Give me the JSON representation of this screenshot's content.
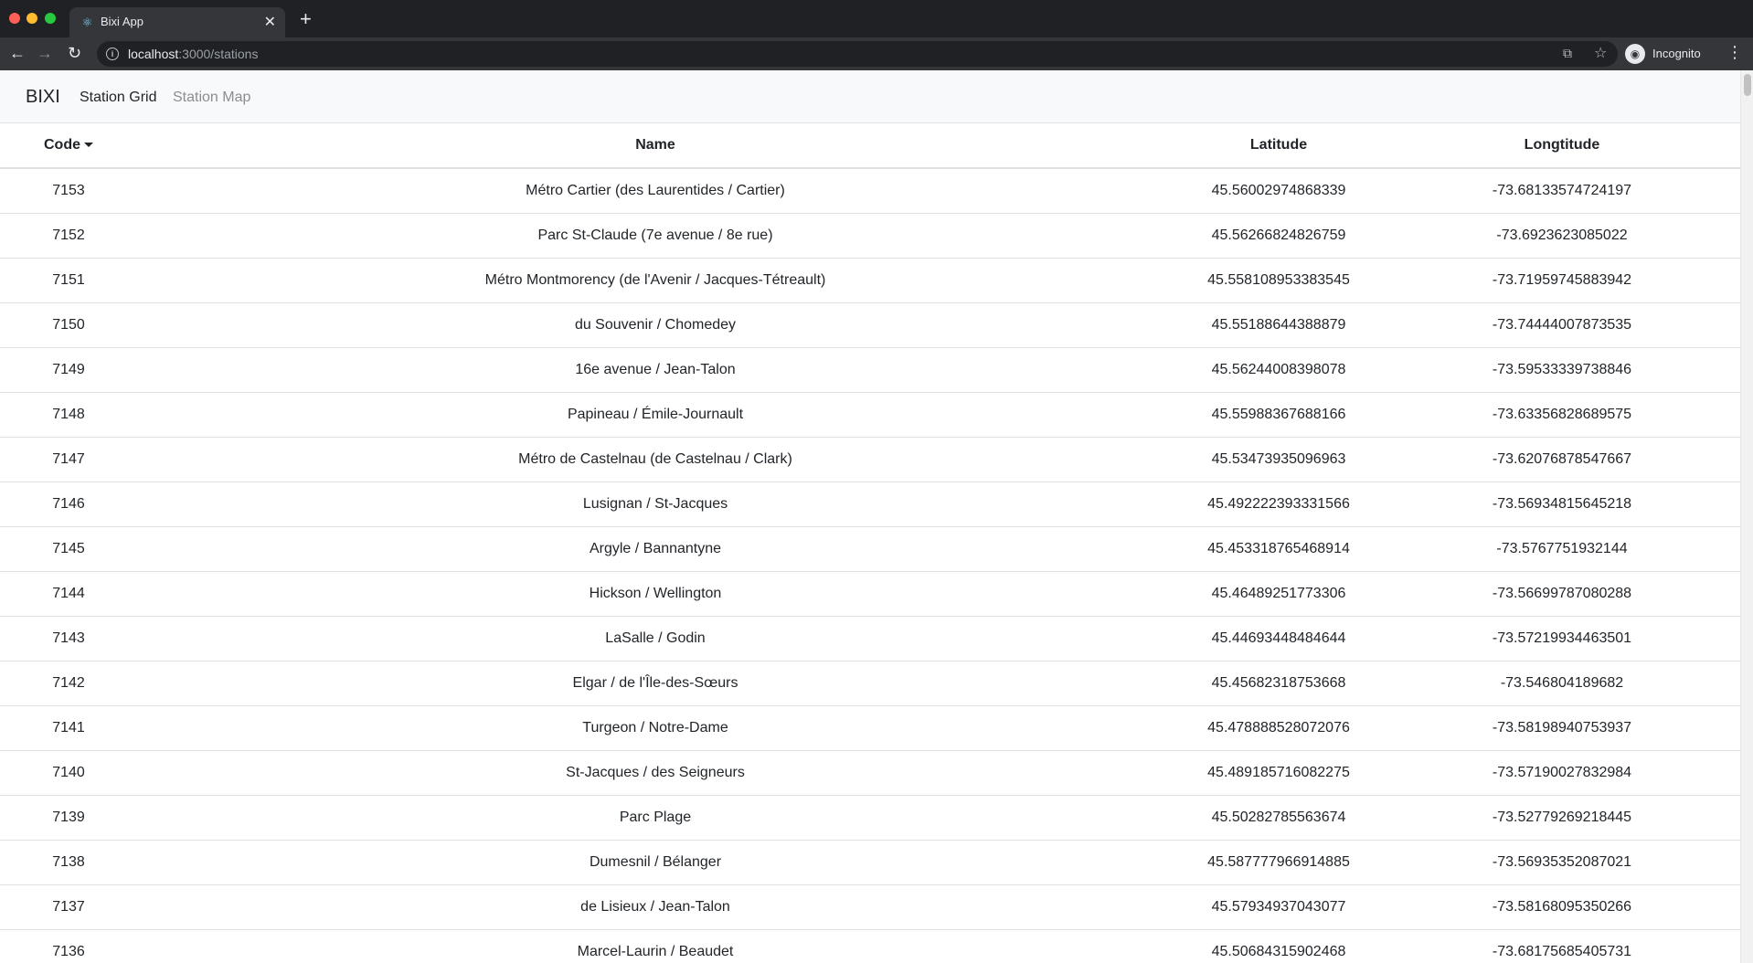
{
  "browser": {
    "tab_title": "Bixi App",
    "url_host": "localhost",
    "url_path": ":3000/stations",
    "profile_label": "Incognito"
  },
  "navbar": {
    "brand": "BIXI",
    "links": [
      {
        "label": "Station Grid",
        "active": true
      },
      {
        "label": "Station Map",
        "active": false
      }
    ]
  },
  "table": {
    "headers": {
      "code": "Code",
      "name": "Name",
      "latitude": "Latitude",
      "longitude": "Longtitude"
    },
    "sort": {
      "column": "code",
      "direction": "desc"
    },
    "rows": [
      {
        "code": "7153",
        "name": "Métro Cartier (des Laurentides / Cartier)",
        "latitude": "45.56002974868339",
        "longitude": "-73.68133574724197"
      },
      {
        "code": "7152",
        "name": "Parc St-Claude (7e avenue / 8e rue)",
        "latitude": "45.56266824826759",
        "longitude": "-73.6923623085022"
      },
      {
        "code": "7151",
        "name": "Métro Montmorency (de l'Avenir / Jacques-Tétreault)",
        "latitude": "45.558108953383545",
        "longitude": "-73.71959745883942"
      },
      {
        "code": "7150",
        "name": "du Souvenir / Chomedey",
        "latitude": "45.55188644388879",
        "longitude": "-73.74444007873535"
      },
      {
        "code": "7149",
        "name": "16e avenue / Jean-Talon",
        "latitude": "45.56244008398078",
        "longitude": "-73.59533339738846"
      },
      {
        "code": "7148",
        "name": "Papineau / Émile-Journault",
        "latitude": "45.55988367688166",
        "longitude": "-73.63356828689575"
      },
      {
        "code": "7147",
        "name": "Métro de Castelnau (de Castelnau / Clark)",
        "latitude": "45.53473935096963",
        "longitude": "-73.62076878547667"
      },
      {
        "code": "7146",
        "name": "Lusignan / St-Jacques",
        "latitude": "45.492222393331566",
        "longitude": "-73.56934815645218"
      },
      {
        "code": "7145",
        "name": "Argyle / Bannantyne",
        "latitude": "45.453318765468914",
        "longitude": "-73.5767751932144"
      },
      {
        "code": "7144",
        "name": "Hickson / Wellington",
        "latitude": "45.46489251773306",
        "longitude": "-73.56699787080288"
      },
      {
        "code": "7143",
        "name": "LaSalle / Godin",
        "latitude": "45.44693448484644",
        "longitude": "-73.57219934463501"
      },
      {
        "code": "7142",
        "name": "Elgar / de l'Île-des-Sœurs",
        "latitude": "45.45682318753668",
        "longitude": "-73.546804189682"
      },
      {
        "code": "7141",
        "name": "Turgeon / Notre-Dame",
        "latitude": "45.478888528072076",
        "longitude": "-73.58198940753937"
      },
      {
        "code": "7140",
        "name": "St-Jacques / des Seigneurs",
        "latitude": "45.489185716082275",
        "longitude": "-73.57190027832984"
      },
      {
        "code": "7139",
        "name": "Parc Plage",
        "latitude": "45.50282785563674",
        "longitude": "-73.52779269218445"
      },
      {
        "code": "7138",
        "name": "Dumesnil / Bélanger",
        "latitude": "45.587777966914885",
        "longitude": "-73.56935352087021"
      },
      {
        "code": "7137",
        "name": "de Lisieux / Jean-Talon",
        "latitude": "45.57934937043077",
        "longitude": "-73.58168095350266"
      },
      {
        "code": "7136",
        "name": "Marcel-Laurin / Beaudet",
        "latitude": "45.50684315902468",
        "longitude": "-73.68175685405731"
      }
    ]
  }
}
